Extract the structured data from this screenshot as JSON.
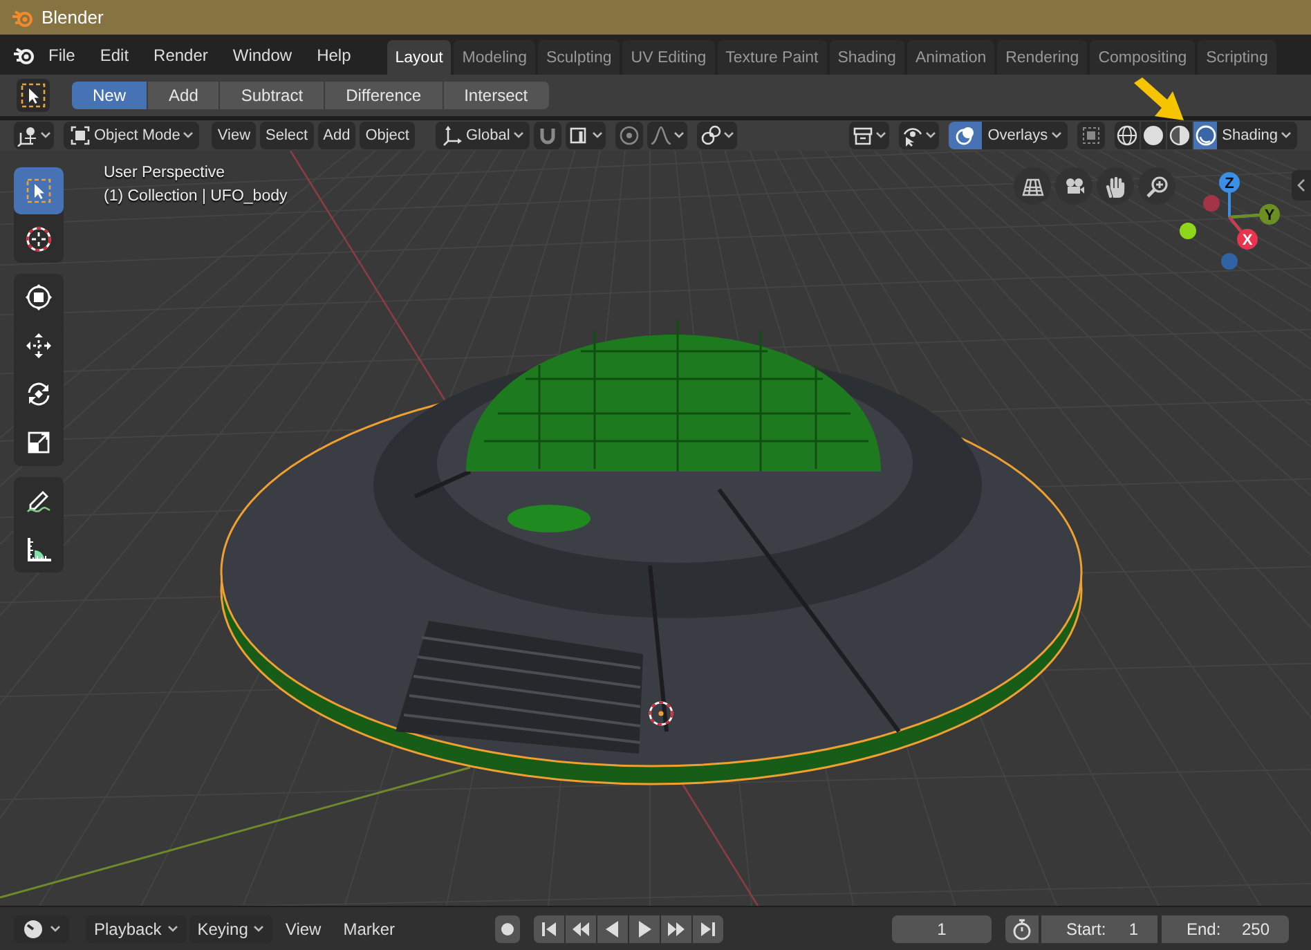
{
  "window": {
    "title": "Blender"
  },
  "menu": [
    "File",
    "Edit",
    "Render",
    "Window",
    "Help"
  ],
  "workspace_tabs": [
    {
      "label": "Layout",
      "selected": true
    },
    {
      "label": "Modeling",
      "selected": false
    },
    {
      "label": "Sculpting",
      "selected": false
    },
    {
      "label": "UV Editing",
      "selected": false
    },
    {
      "label": "Texture Paint",
      "selected": false
    },
    {
      "label": "Shading",
      "selected": false
    },
    {
      "label": "Animation",
      "selected": false
    },
    {
      "label": "Rendering",
      "selected": false
    },
    {
      "label": "Compositing",
      "selected": false
    },
    {
      "label": "Scripting",
      "selected": false
    }
  ],
  "tool_settings": {
    "mode_buttons": [
      {
        "label": "New",
        "selected": true
      },
      {
        "label": "Add",
        "selected": false
      },
      {
        "label": "Subtract",
        "selected": false
      },
      {
        "label": "Difference",
        "selected": false
      },
      {
        "label": "Intersect",
        "selected": false
      }
    ]
  },
  "viewport_header": {
    "mode": "Object Mode",
    "menus": [
      "View",
      "Select",
      "Add",
      "Object"
    ],
    "transform_orientation": "Global",
    "overlays": {
      "label": "Overlays",
      "on": true
    },
    "shading_modes": [
      {
        "kind": "wireframe",
        "selected": false
      },
      {
        "kind": "solid",
        "selected": false
      },
      {
        "kind": "material",
        "selected": false
      },
      {
        "kind": "rendered",
        "selected": true
      }
    ],
    "shading": "Shading"
  },
  "toolbar_groups": [
    {
      "tools": [
        {
          "kind": "select",
          "selected": true
        },
        {
          "kind": "cursor",
          "selected": false
        }
      ]
    },
    {
      "tools": [
        {
          "kind": "transform",
          "selected": false
        },
        {
          "kind": "move",
          "selected": false
        },
        {
          "kind": "rotate",
          "selected": false
        },
        {
          "kind": "scale",
          "selected": false
        }
      ]
    },
    {
      "tools": [
        {
          "kind": "annotate",
          "selected": false
        },
        {
          "kind": "measure",
          "selected": false
        }
      ]
    }
  ],
  "viewport": {
    "view_name": "User Perspective",
    "object_info": "(1) Collection | UFO_body",
    "gizmo_axes": [
      "X",
      "Y",
      "Z"
    ]
  },
  "timeline": {
    "menus": [
      {
        "label": "Playback",
        "kind": "dropdown"
      },
      {
        "label": "Keying",
        "kind": "dropdown"
      },
      {
        "label": "View",
        "kind": "menu"
      },
      {
        "label": "Marker",
        "kind": "menu"
      }
    ],
    "current_frame": "1",
    "start_label": "Start:",
    "start": "1",
    "end_label": "End:",
    "end": "250"
  }
}
